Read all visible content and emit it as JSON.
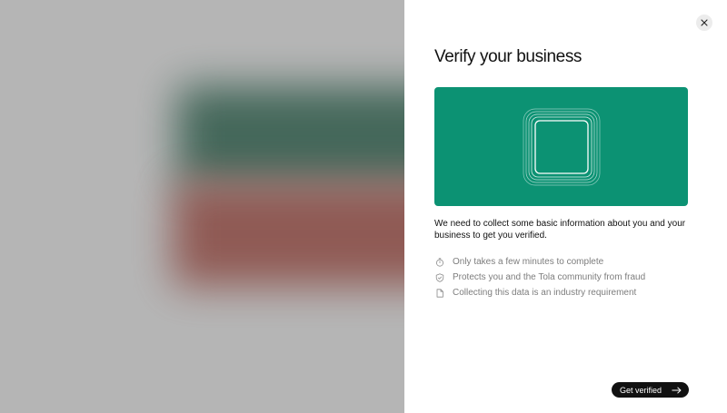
{
  "modal": {
    "title": "Verify your business",
    "intro": "We need to collect some basic information about you and your business to get you verified.",
    "bullets": [
      {
        "icon": "stopwatch-icon",
        "text": "Only takes a few minutes to complete"
      },
      {
        "icon": "shield-check-icon",
        "text": "Protects you and the Tola community from fraud"
      },
      {
        "icon": "document-icon",
        "text": "Collecting this data is an industry requirement"
      }
    ],
    "cta_label": "Get verified",
    "cta_icon": "arrow-right-icon",
    "close_icon": "close-icon"
  },
  "colors": {
    "accent": "#0c9273",
    "button": "#111111",
    "muted_text": "#7d7d7d"
  }
}
